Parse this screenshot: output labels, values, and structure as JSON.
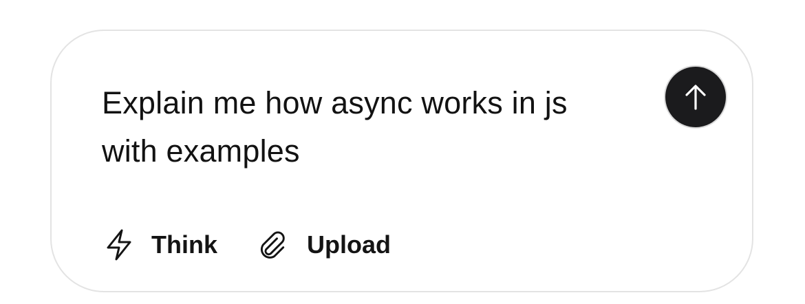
{
  "composer": {
    "prompt_text": "Explain me how async works in js with examples",
    "send_button": {
      "icon": "arrow-up-icon",
      "color": "#1b1b1d"
    },
    "tools": [
      {
        "label": "Think",
        "icon": "lightning-bolt-icon"
      },
      {
        "label": "Upload",
        "icon": "paperclip-icon"
      }
    ]
  },
  "colors": {
    "border": "#e3e3e3",
    "text": "#121212",
    "send_bg": "#1b1b1d",
    "send_arrow": "#ffffff"
  }
}
